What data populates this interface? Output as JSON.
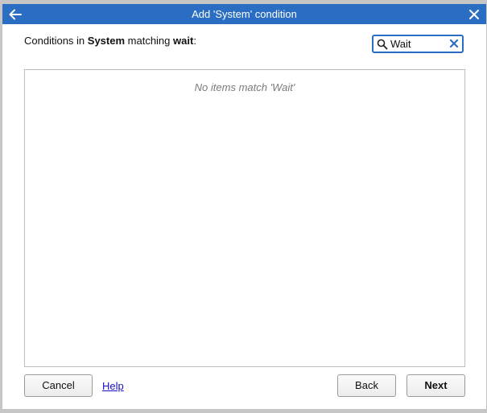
{
  "dialog": {
    "title": "Add 'System' condition",
    "back_icon": "arrow-left-icon",
    "close_icon": "close-icon"
  },
  "prompt": {
    "prefix": "Conditions in ",
    "category": "System",
    "middle": " matching ",
    "query": "wait",
    "suffix": ":"
  },
  "search": {
    "value": "Wait",
    "icon": "search-icon",
    "clear_icon": "clear-icon"
  },
  "results": {
    "empty_message": "No items match 'Wait'"
  },
  "buttons": {
    "cancel": "Cancel",
    "help": "Help",
    "back": "Back",
    "next": "Next"
  },
  "colors": {
    "titlebar": "#2a6ec3",
    "focus_border": "#2a6ec3",
    "link": "#1a0dcc"
  }
}
